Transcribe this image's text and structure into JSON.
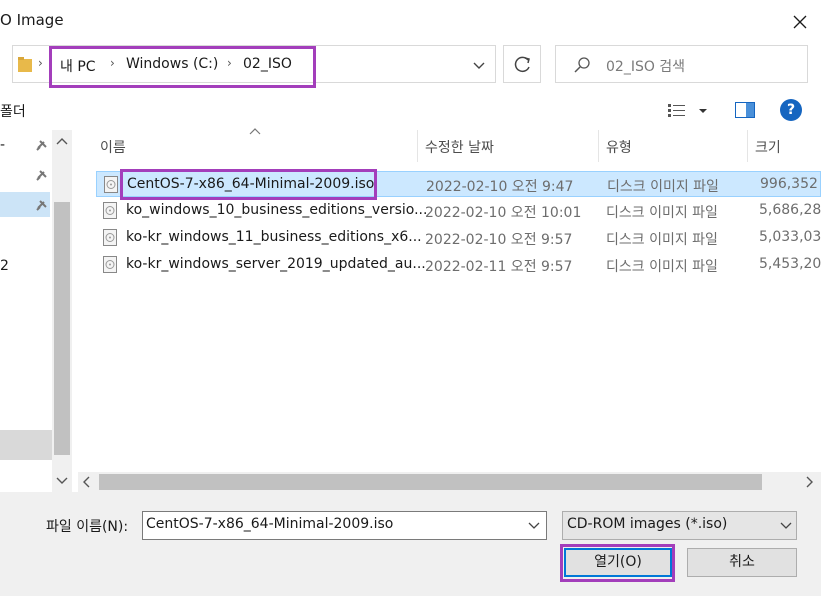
{
  "window": {
    "title": "O Image",
    "close_icon": "close-icon"
  },
  "address": {
    "breadcrumb": [
      "내 PC",
      "Windows (C:)",
      "02_ISO"
    ],
    "highlight_color": "#a33ebb"
  },
  "search": {
    "placeholder": "02_ISO 검색"
  },
  "toolbar": {
    "new_folder_label": "폴더"
  },
  "nav": {
    "label_row1": "-",
    "label_row4": "2"
  },
  "columns": {
    "name": "이름",
    "date": "수정한 날짜",
    "type": "유형",
    "size": "크기"
  },
  "files": [
    {
      "name": "CentOS-7-x86_64-Minimal-2009.iso",
      "date": "2022-02-10 오전 9:47",
      "type": "디스크 이미지 파일",
      "size": "996,352",
      "selected": true
    },
    {
      "name": "ko_windows_10_business_editions_versio...",
      "date": "2022-02-10 오전 10:01",
      "type": "디스크 이미지 파일",
      "size": "5,686,286",
      "selected": false
    },
    {
      "name": "ko-kr_windows_11_business_editions_x6...",
      "date": "2022-02-10 오전 9:57",
      "type": "디스크 이미지 파일",
      "size": "5,033,032",
      "selected": false
    },
    {
      "name": "ko-kr_windows_server_2019_updated_au...",
      "date": "2022-02-11 오전 9:57",
      "type": "디스크 이미지 파일",
      "size": "5,453,206",
      "selected": false
    }
  ],
  "footer": {
    "filename_label": "파일 이름(N):",
    "filename_value": "CentOS-7-x86_64-Minimal-2009.iso",
    "filter_value": "CD-ROM images (*.iso)",
    "open_label": "열기(O)",
    "cancel_label": "취소"
  },
  "colors": {
    "accent": "#0078d7",
    "selection": "#cce8ff",
    "annotation": "#a33ebb"
  }
}
